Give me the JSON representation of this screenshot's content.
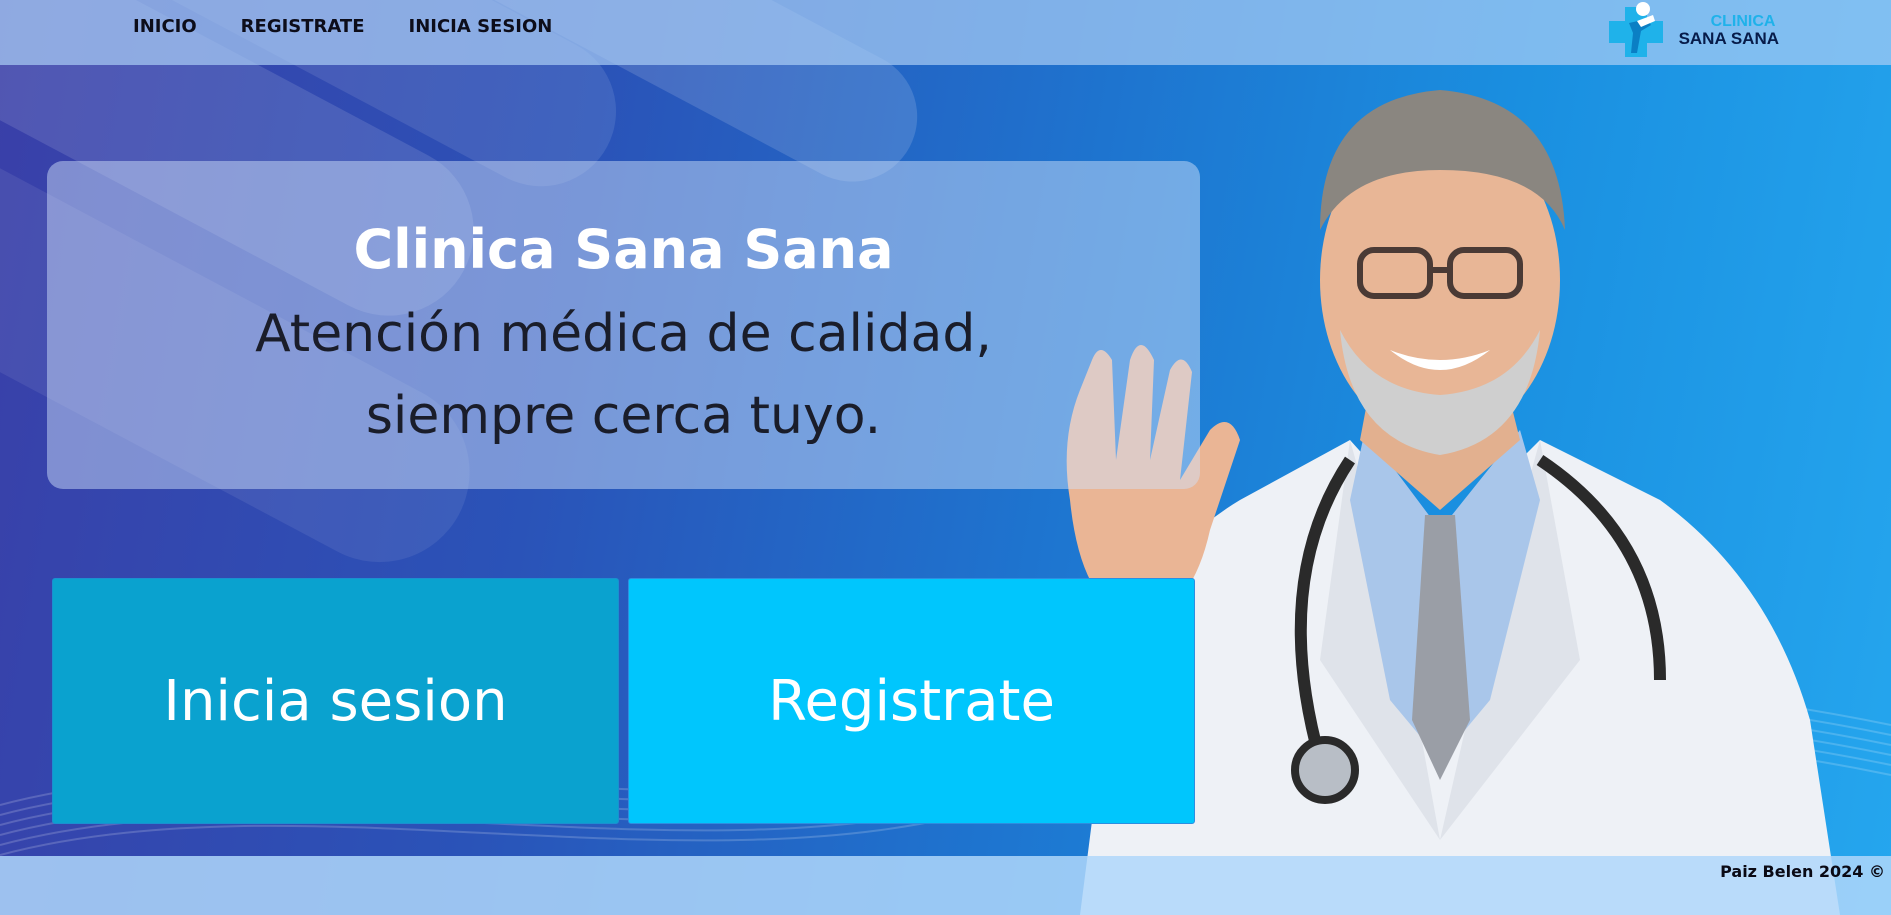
{
  "nav": {
    "items": [
      {
        "label": "INICIO"
      },
      {
        "label": "REGISTRATE"
      },
      {
        "label": "INICIA SESION"
      }
    ]
  },
  "logo": {
    "line1": "CLINICA",
    "line2": "SANA SANA",
    "icon": "medical-cross-person-icon"
  },
  "hero": {
    "title": "Clinica Sana Sana",
    "subtitle_line1": "Atención médica de calidad,",
    "subtitle_line2": "siempre cerca tuyo."
  },
  "buttons": {
    "login_label": "Inicia sesion",
    "register_label": "Registrate"
  },
  "footer": {
    "text": "Paiz Belen 2024 ©"
  },
  "colors": {
    "login_button": "#0aa2cf",
    "register_button": "#00c6fd",
    "logo_accent": "#1fb2ea"
  }
}
